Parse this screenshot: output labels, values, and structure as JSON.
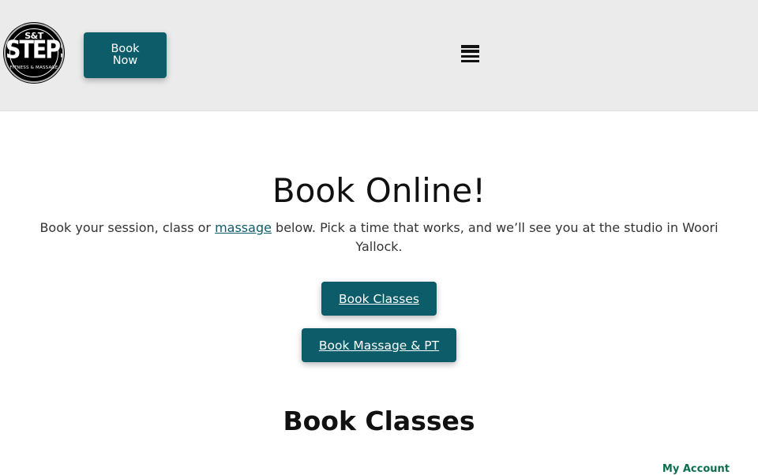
{
  "header": {
    "logo": {
      "top_text": "S&T",
      "main_text": "STEPS",
      "sub_text": "FITNESS & MASSAGE"
    },
    "book_now_label": "Book Now",
    "menu_icon": "hamburger-menu-icon"
  },
  "main": {
    "title": "Book Online!",
    "intro_before": "Book your session, class or ",
    "intro_link": "massage",
    "intro_after": " below. Pick a time that works, and we’ll see you at the studio in Woori Yallock.",
    "buttons": {
      "classes_label": "Book Classes",
      "massage_label": "Book Massage & PT"
    },
    "section_title": "Book Classes",
    "my_account_label": "My Account"
  },
  "colors": {
    "accent": "#0d5c6a",
    "header_bg": "#ebebeb",
    "account_link": "#0d6e4e"
  }
}
